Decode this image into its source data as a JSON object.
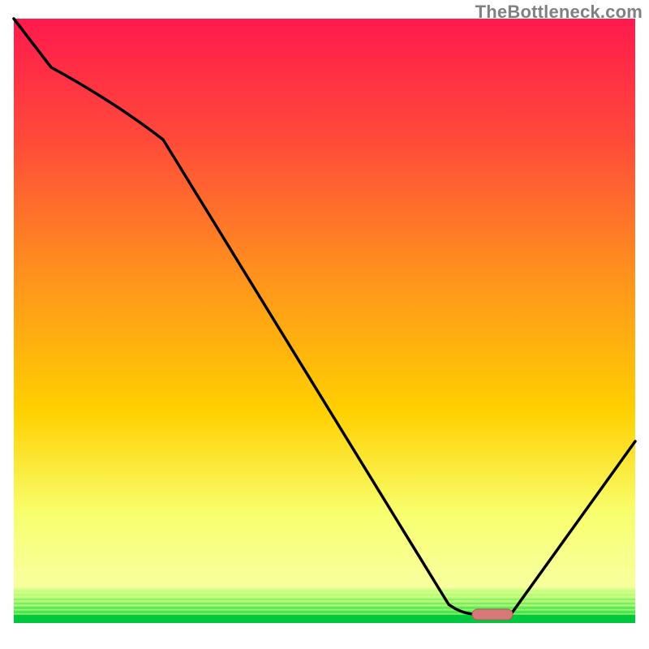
{
  "watermark": "TheBottleneck.com",
  "colors": {
    "top": "#ff1a4d",
    "mid": "#ffd000",
    "lower": "#f8ff6e",
    "green": "#00e05a",
    "curve": "#000000",
    "marker_fill": "#d57a78",
    "marker_stroke": "#b85a58"
  },
  "chart_data": {
    "type": "line",
    "title": "",
    "xlabel": "",
    "ylabel": "",
    "xlim": [
      0,
      100
    ],
    "ylim": [
      0,
      100
    ],
    "series": [
      {
        "name": "bottleneck-curve",
        "x": [
          0,
          6,
          24,
          70,
          74,
          80,
          100
        ],
        "values": [
          100,
          92,
          80,
          3,
          1.5,
          1.5,
          30
        ]
      }
    ],
    "annotations": [
      {
        "name": "current-config-marker",
        "x_start": 74,
        "x_end": 80,
        "y": 1.5,
        "shape": "pill"
      }
    ]
  }
}
